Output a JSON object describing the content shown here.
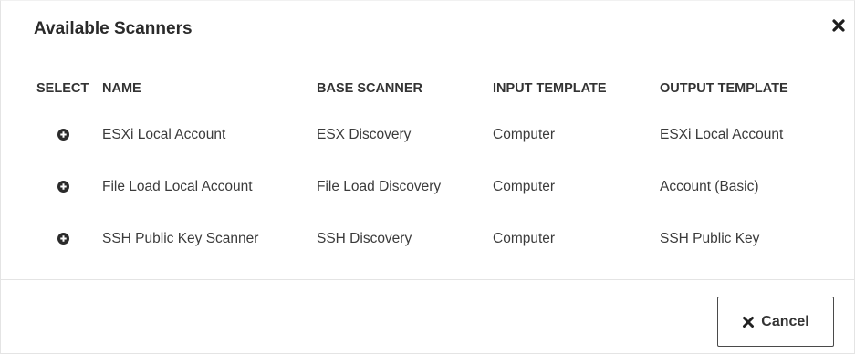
{
  "dialog": {
    "title": "Available Scanners",
    "close_icon": "close-icon"
  },
  "table": {
    "columns": [
      "SELECT",
      "NAME",
      "BASE SCANNER",
      "INPUT TEMPLATE",
      "OUTPUT TEMPLATE"
    ],
    "rows": [
      {
        "select_icon": "plus-circle-icon",
        "name": "ESXi Local Account",
        "base_scanner": "ESX Discovery",
        "input_template": "Computer",
        "output_template": "ESXi Local Account"
      },
      {
        "select_icon": "plus-circle-icon",
        "name": "File Load Local Account",
        "base_scanner": "File Load Discovery",
        "input_template": "Computer",
        "output_template": "Account (Basic)"
      },
      {
        "select_icon": "plus-circle-icon",
        "name": "SSH Public Key Scanner",
        "base_scanner": "SSH Discovery",
        "input_template": "Computer",
        "output_template": "SSH Public Key"
      }
    ]
  },
  "footer": {
    "cancel_label": "Cancel",
    "cancel_icon": "x-icon"
  },
  "colors": {
    "text": "#333333",
    "border": "#e4e4e4",
    "icon": "#2b2b2b"
  }
}
